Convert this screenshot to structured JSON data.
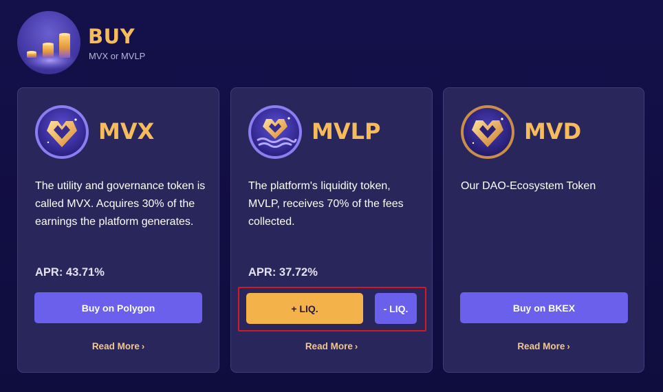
{
  "header": {
    "title": "BUY",
    "subtitle": "MVX or MVLP",
    "icon": "bar-chart-icon"
  },
  "cards": [
    {
      "token": "MVX",
      "description": "The utility and governance token is called MVX. Acquires 30% of the earnings the platform generates.",
      "apr": "APR: 43.71%",
      "button_label": "Buy on Polygon",
      "read_more": "Read More"
    },
    {
      "token": "MVLP",
      "description": "The platform's liquidity token, MVLP, receives 70% of the fees collected.",
      "apr": "APR: 37.72%",
      "add_liq_label": "+ LIQ.",
      "remove_liq_label": "- LIQ.",
      "read_more": "Read More"
    },
    {
      "token": "MVD",
      "description": "Our DAO-Ecosystem Token",
      "button_label": "Buy on BKEX",
      "read_more": "Read More"
    }
  ],
  "colors": {
    "background": "#14104a",
    "card": "#28265a",
    "accent_gold": "#f6bb5c",
    "button_purple": "#6a60eb",
    "button_gold": "#f4b24a",
    "highlight_red": "#d11a24"
  },
  "icons": {
    "token_logo": "heart-coin-icon",
    "chevron": "chevron-right-icon"
  }
}
